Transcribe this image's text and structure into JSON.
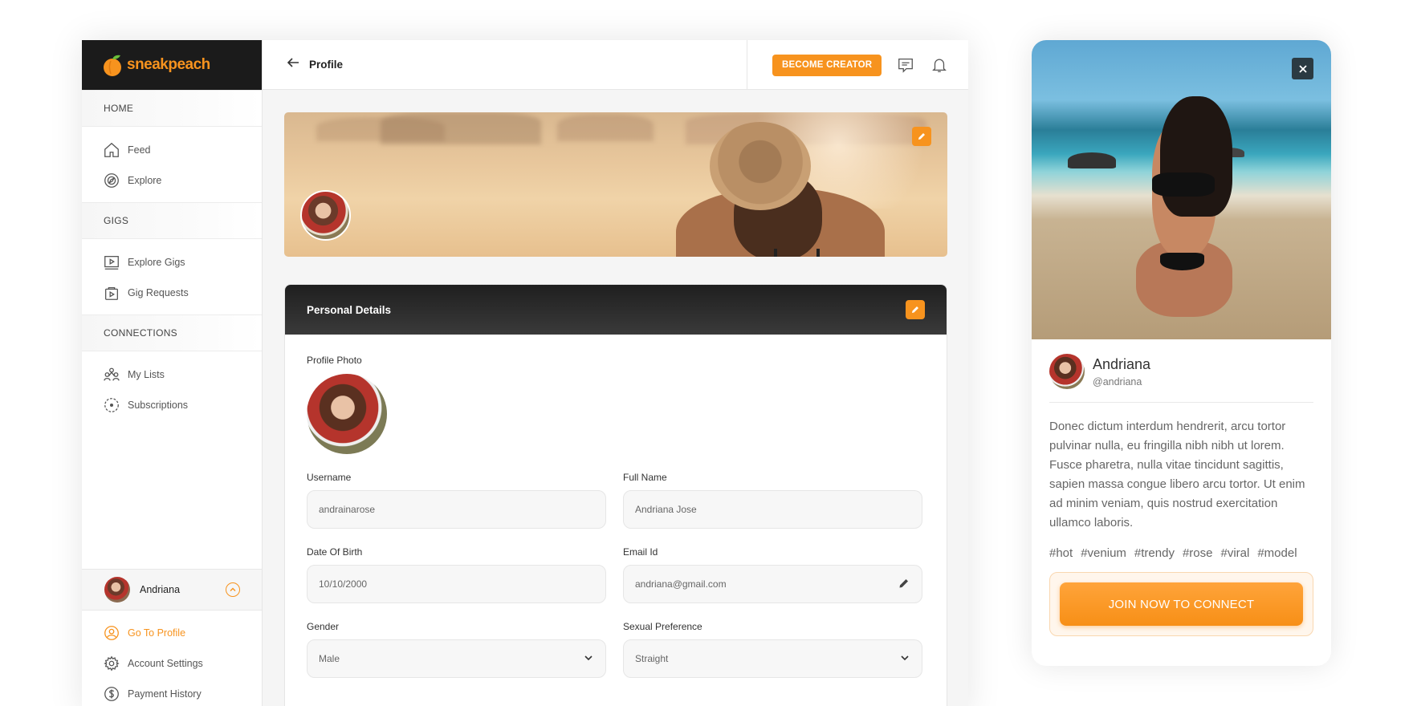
{
  "brand": {
    "name": "sneakpeach",
    "accent": "#f7931e"
  },
  "sidebar": {
    "sections": [
      {
        "heading": "HOME",
        "items": [
          {
            "label": "Feed",
            "icon": "home-icon"
          },
          {
            "label": "Explore",
            "icon": "compass-icon"
          }
        ]
      },
      {
        "heading": "GIGS",
        "items": [
          {
            "label": "Explore Gigs",
            "icon": "play-screen-icon"
          },
          {
            "label": "Gig Requests",
            "icon": "bag-play-icon"
          }
        ]
      },
      {
        "heading": "CONNECTIONS",
        "items": [
          {
            "label": "My Lists",
            "icon": "people-icon"
          },
          {
            "label": "Subscriptions",
            "icon": "dotted-circle-icon"
          }
        ]
      }
    ],
    "user": {
      "name": "Andriana"
    },
    "user_menu": [
      {
        "label": "Go To Profile",
        "icon": "user-circle-icon",
        "active": true
      },
      {
        "label": "Account Settings",
        "icon": "gear-icon"
      },
      {
        "label": "Payment History",
        "icon": "dollar-icon"
      }
    ]
  },
  "topbar": {
    "title": "Profile",
    "become_creator": "BECOME CREATOR"
  },
  "personal": {
    "title": "Personal Details",
    "profile_photo_label": "Profile Photo",
    "fields": {
      "username": {
        "label": "Username",
        "value": "andrainarose"
      },
      "full_name": {
        "label": "Full Name",
        "value": "Andriana Jose"
      },
      "dob": {
        "label": "Date Of Birth",
        "value": "10/10/2000"
      },
      "email": {
        "label": "Email Id",
        "value": "andriana@gmail.com"
      },
      "gender": {
        "label": "Gender",
        "value": "Male"
      },
      "preference": {
        "label": "Sexual Preference",
        "value": "Straight"
      }
    }
  },
  "profile_card": {
    "name": "Andriana",
    "handle": "@andriana",
    "bio": "Donec dictum interdum hendrerit, arcu tortor pulvinar nulla, eu fringilla nibh nibh ut lorem. Fusce pharetra, nulla vitae tincidunt sagittis, sapien massa congue libero arcu tortor. Ut enim ad minim veniam, quis nostrud exercitation ullamco laboris.",
    "tags": [
      "#hot",
      "#venium",
      "#trendy",
      "#rose",
      "#viral",
      "#model"
    ],
    "cta": "JOIN NOW TO CONNECT"
  }
}
